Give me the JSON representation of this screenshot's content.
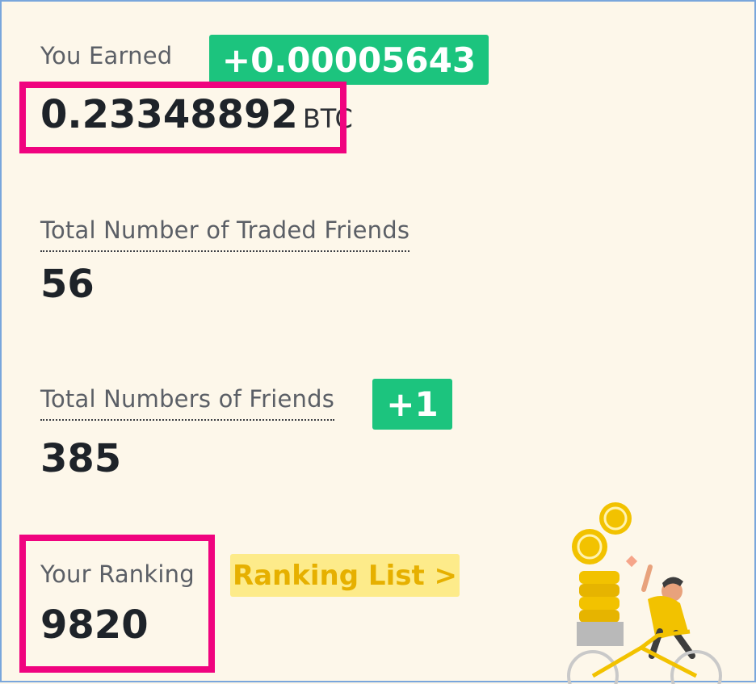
{
  "earned": {
    "label": "You Earned",
    "amount": "0.23348892",
    "unit": "BTC",
    "change_badge": "+0.00005643"
  },
  "traded_friends": {
    "label": "Total Number of Traded Friends",
    "value": "56"
  },
  "friends": {
    "label": "Total Numbers of Friends",
    "value": "385",
    "change_badge": "+1"
  },
  "ranking": {
    "label": "Your Ranking",
    "value": "9820",
    "list_button": "Ranking List >"
  },
  "colors": {
    "background": "#fdf7ea",
    "positive_badge": "#1cc47e",
    "highlight": "#f0037f",
    "ranking_button_bg": "#fdeb8a",
    "ranking_button_text": "#e6b000"
  },
  "icons": {
    "illustration": "cyclist-with-coins-illustration"
  }
}
